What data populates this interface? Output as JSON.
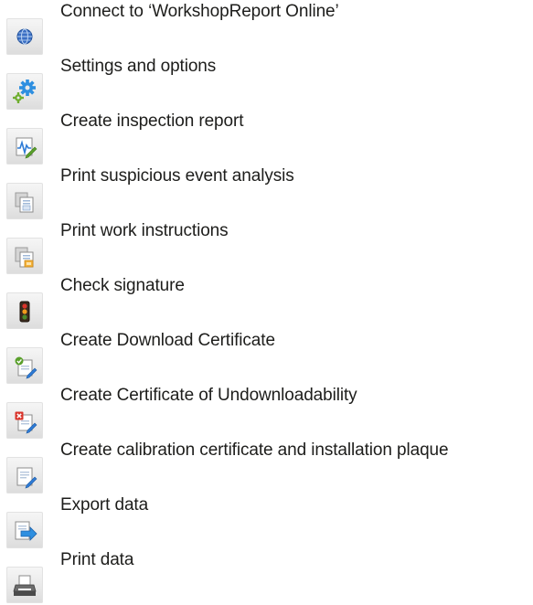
{
  "menu": {
    "items": [
      {
        "label": "Connect to ‘WorkshopReport Online’",
        "icon": "globe-icon"
      },
      {
        "label": "Settings and options",
        "icon": "gears-icon"
      },
      {
        "label": "Create inspection report",
        "icon": "report-pen-icon"
      },
      {
        "label": "Print suspicious event analysis",
        "icon": "print-analysis-icon"
      },
      {
        "label": "Print work instructions",
        "icon": "print-instructions-icon"
      },
      {
        "label": "Check signature",
        "icon": "traffic-light-icon"
      },
      {
        "label": "Create Download Certificate",
        "icon": "certificate-check-icon"
      },
      {
        "label": "Create Certificate of Undownloadability",
        "icon": "certificate-cross-icon"
      },
      {
        "label": "Create calibration certificate and installation plaque",
        "icon": "certificate-edit-icon"
      },
      {
        "label": "Export data",
        "icon": "export-arrow-icon"
      },
      {
        "label": "Print data",
        "icon": "printer-icon"
      }
    ]
  },
  "colors": {
    "text": "#1d1d1b",
    "icon_background": "#e9e9e9",
    "accent_blue": "#2e7bd6",
    "accent_green": "#5aa02c",
    "accent_red": "#d9342b",
    "accent_orange": "#f29a1b"
  }
}
